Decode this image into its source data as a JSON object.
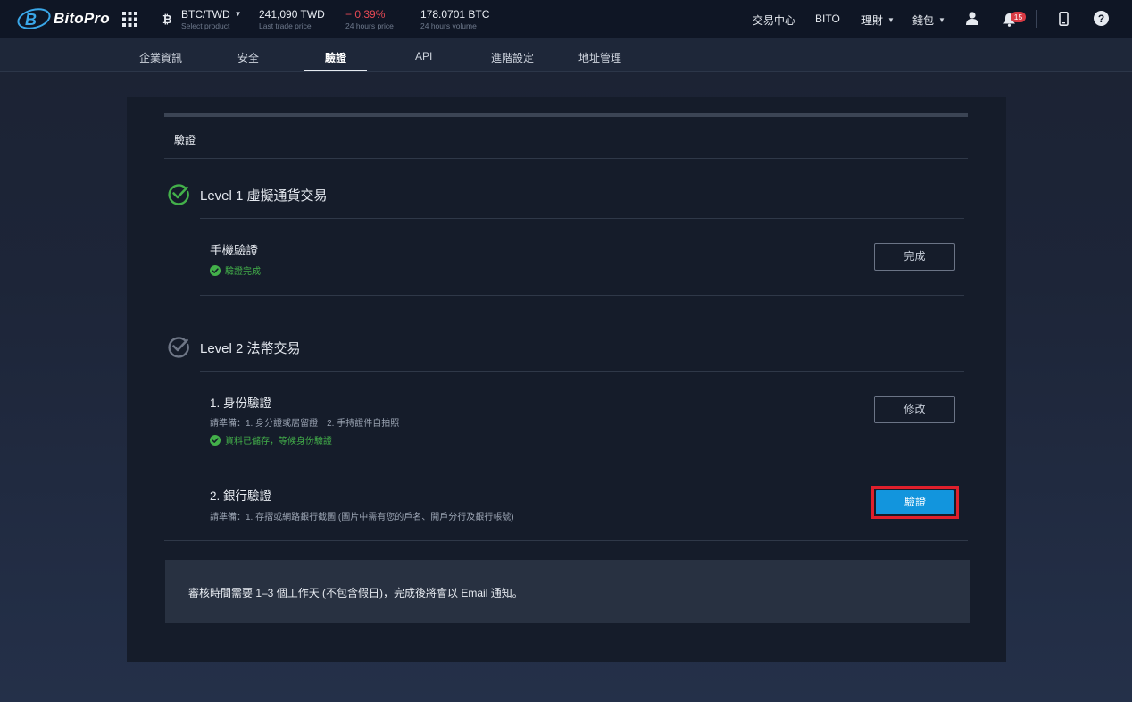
{
  "brand": {
    "name": "BitoPro"
  },
  "market": {
    "pair": "BTC/TWD",
    "pair_sub": "Select product",
    "last_price": "241,090 TWD",
    "last_price_sub": "Last trade price",
    "change": "− 0.39%",
    "change_sub": "24 hours price",
    "volume": "178.0701 BTC",
    "volume_sub": "24 hours volume"
  },
  "nav": {
    "trade_center": "交易中心",
    "bito": "BITO",
    "finance": "理財",
    "wallet": "錢包",
    "notifications_count": "15"
  },
  "tabs": [
    {
      "label": "企業資訊"
    },
    {
      "label": "安全"
    },
    {
      "label": "驗證"
    },
    {
      "label": "API"
    },
    {
      "label": "進階設定"
    },
    {
      "label": "地址管理"
    }
  ],
  "active_tab": "驗證",
  "section_title": "驗證",
  "level1": {
    "title": "Level 1 虛擬通貨交易",
    "items": [
      {
        "title": "手機驗證",
        "status": "驗證完成",
        "button": "完成"
      }
    ]
  },
  "level2": {
    "title": "Level 2 法幣交易",
    "items": [
      {
        "title": "1. 身份驗證",
        "note": "請準備：1. 身分證或居留證　2. 手持證件自拍照",
        "status": "資料已儲存，等候身份驗證",
        "button": "修改"
      },
      {
        "title": "2. 銀行驗證",
        "note": "請準備：1. 存摺或網路銀行截圖 (圖片中需有您的戶名、開戶分行及銀行帳號)",
        "button": "驗證"
      }
    ]
  },
  "notice": "審核時間需要 1–3 個工作天 (不包含假日)，完成後將會以 Email 通知。",
  "colors": {
    "accent": "#1295dd",
    "success": "#43b04a",
    "negative": "#e84a55",
    "highlight": "#e0202c"
  }
}
